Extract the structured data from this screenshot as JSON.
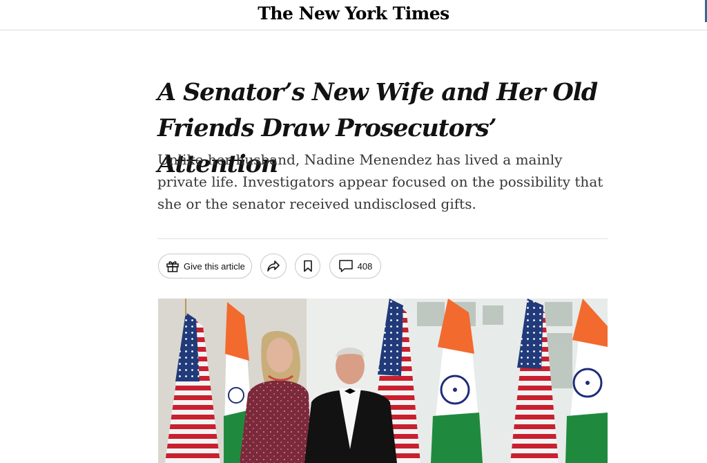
{
  "masthead": {
    "logo_text": "The New York Times"
  },
  "article": {
    "headline": "A Senator’s New Wife and Her Old Friends Draw Prosecutors’ Attention",
    "summary": "Unlike her husband, Nadine Menendez has lived a mainly private life. Investigators appear focused on the possibility that she or the senator received undisclosed gifts."
  },
  "toolbar": {
    "gift_label": "Give this article",
    "gift_icon": "gift-icon",
    "share_icon": "share-arrow-icon",
    "save_icon": "bookmark-icon",
    "comment_icon": "comment-bubble-icon",
    "comment_count": "408"
  },
  "photo": {
    "subject": "photo-couple-flags"
  },
  "colors": {
    "text": "#121212",
    "summary_text": "#363636",
    "border": "#c7c7c7",
    "divider": "#dfdfdf"
  }
}
